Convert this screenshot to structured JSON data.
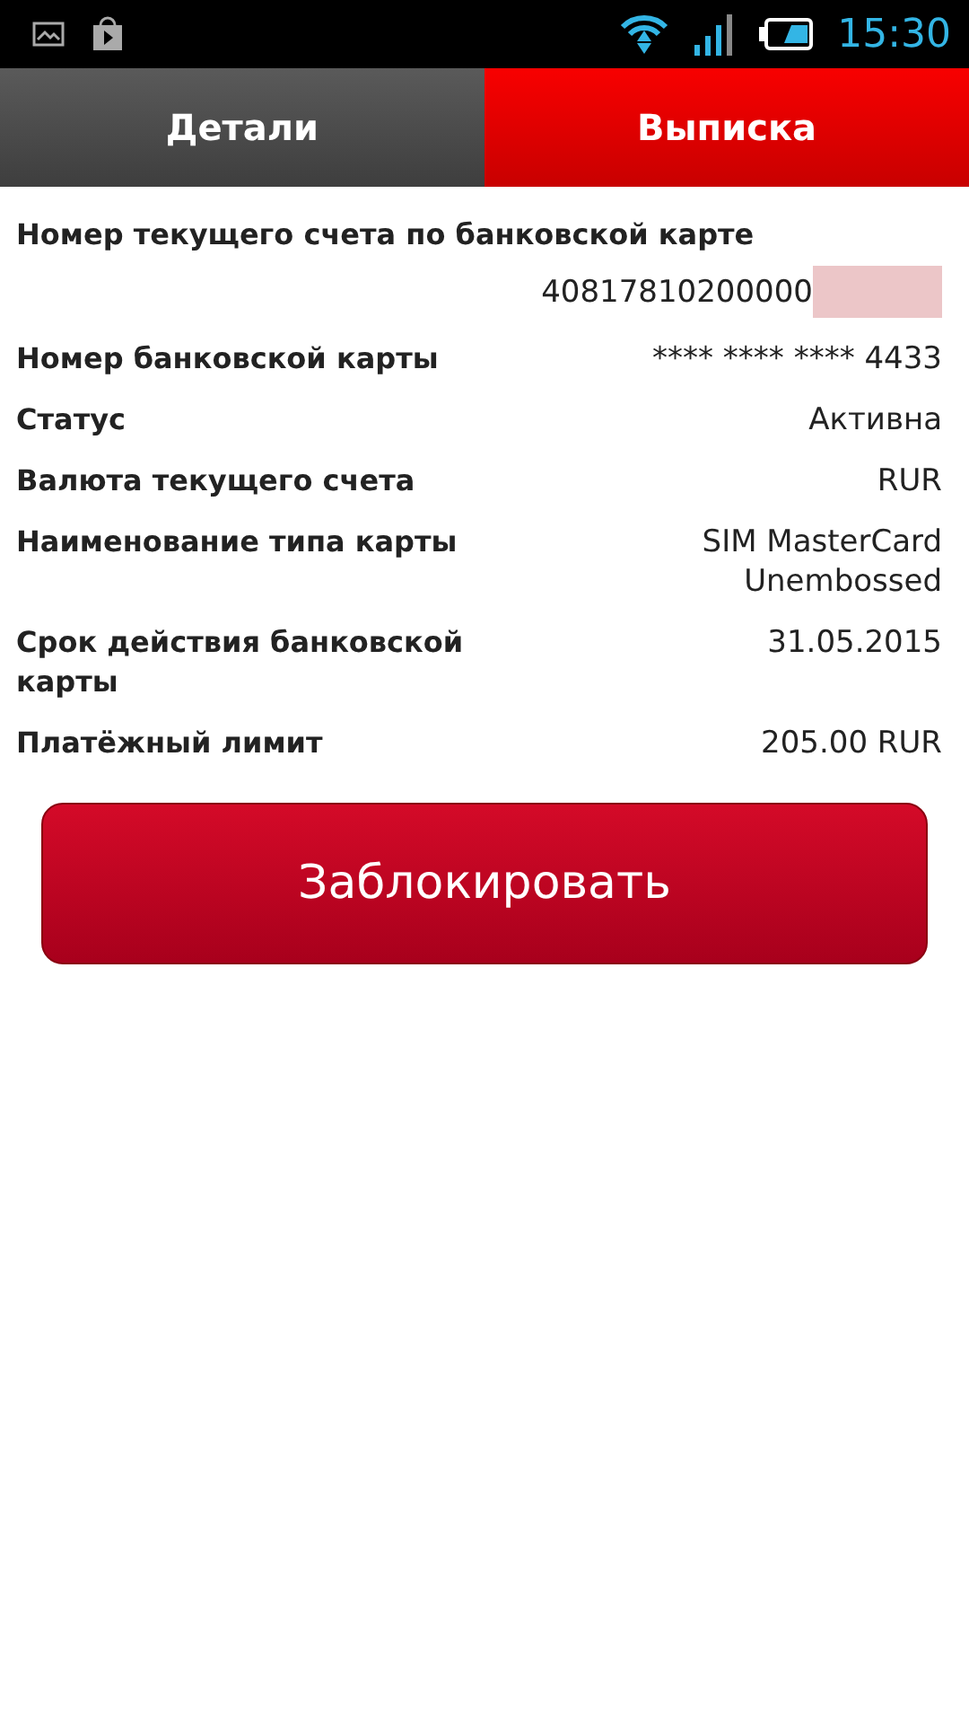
{
  "status_bar": {
    "time": "15:30"
  },
  "tabs": [
    {
      "label": "Детали",
      "selected": false
    },
    {
      "label": "Выписка",
      "selected": true
    }
  ],
  "fields": [
    {
      "kind": "stacked",
      "label": "Номер текущего счета по банковской карте",
      "value": "40817810200000",
      "redacted": true
    },
    {
      "kind": "inline",
      "label": "Номер банковской карты",
      "value": "**** **** **** 4433"
    },
    {
      "kind": "inline",
      "label": "Статус",
      "value": "Активна"
    },
    {
      "kind": "inline",
      "label": "Валюта текущего счета",
      "value": "RUR"
    },
    {
      "kind": "inline",
      "label": "Наименование типа карты",
      "value": "SIM MasterCard Unembossed"
    },
    {
      "kind": "inline",
      "label": "Срок действия банковской карты",
      "value": "31.05.2015"
    },
    {
      "kind": "inline",
      "label": "Платёжный лимит",
      "value": "205.00 RUR"
    }
  ],
  "button": "Заблокировать"
}
